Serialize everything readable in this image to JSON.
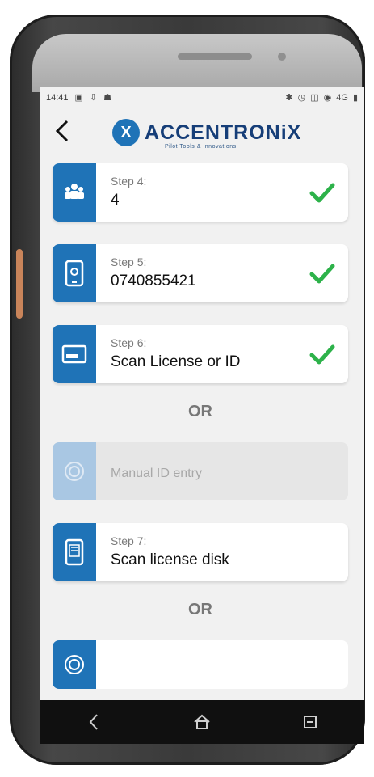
{
  "status": {
    "time": "14:41",
    "left_icons": [
      "image-icon",
      "download-icon",
      "accessibility-icon"
    ],
    "right_icons": [
      "bluetooth-icon",
      "alarm-icon",
      "vibrate-icon",
      "wifi-icon",
      "lte-icon",
      "battery-icon"
    ],
    "network_label": "4G"
  },
  "header": {
    "back_label": "<",
    "logo_mark": "X",
    "logo_text": "ACCENTRONiX",
    "logo_tag": "Pilot Tools & Innovations"
  },
  "steps": [
    {
      "label": "Step 4:",
      "value": "4",
      "icon": "people-icon",
      "checked": true
    },
    {
      "label": "Step 5:",
      "value": "0740855421",
      "icon": "phone-icon",
      "checked": true
    },
    {
      "label": "Step 6:",
      "value": "Scan License or ID",
      "icon": "id-card-icon",
      "checked": true
    }
  ],
  "or_text": "OR",
  "manual": {
    "label": "Manual ID entry",
    "icon": "fingerprint-icon"
  },
  "step7": {
    "label": "Step 7:",
    "value": "Scan license disk",
    "icon": "license-disk-icon"
  },
  "colors": {
    "accent": "#1f73b7",
    "check": "#2db24a"
  }
}
